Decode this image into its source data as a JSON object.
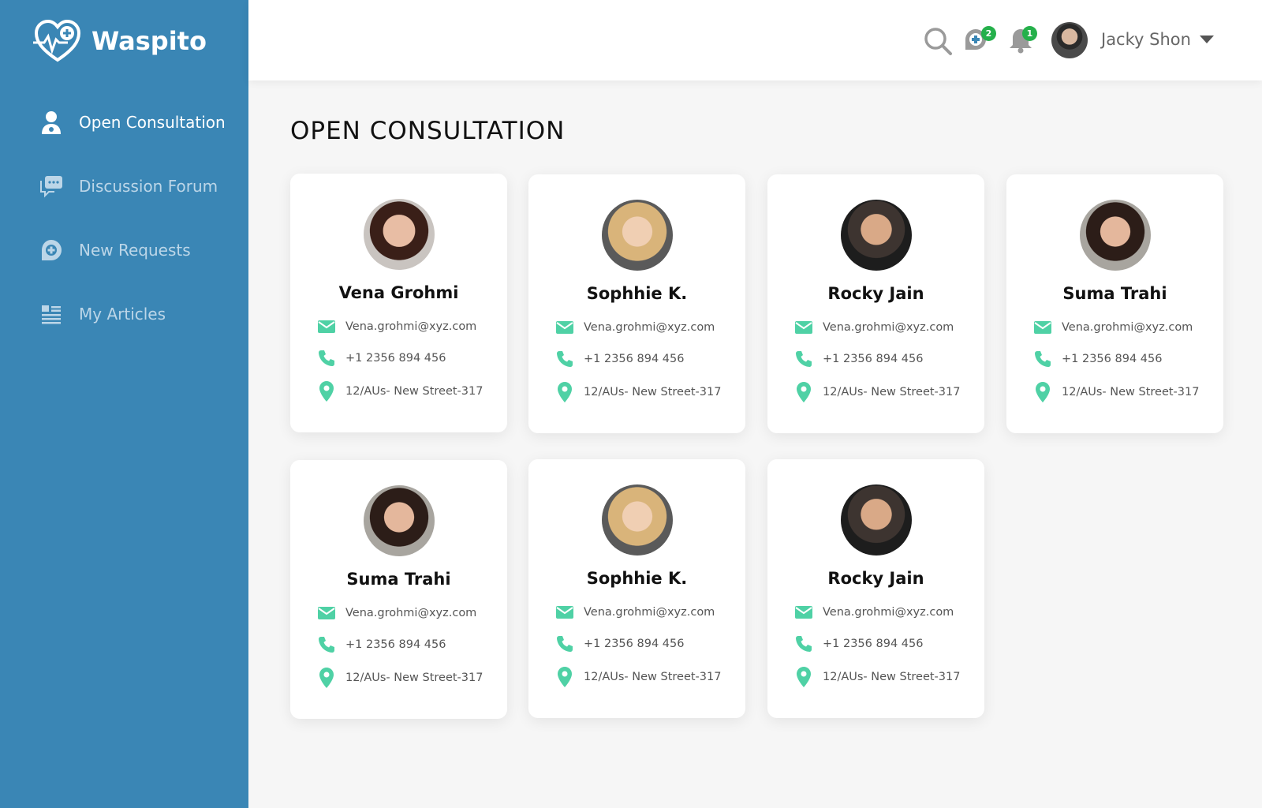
{
  "brand": {
    "name": "Waspito"
  },
  "sidebar": {
    "items": [
      {
        "label": "Open Consultation",
        "icon": "doctor-icon",
        "active": true
      },
      {
        "label": "Discussion Forum",
        "icon": "chat-icon",
        "active": false
      },
      {
        "label": "New Requests",
        "icon": "medical-plus-icon",
        "active": false
      },
      {
        "label": "My Articles",
        "icon": "articles-icon",
        "active": false
      }
    ]
  },
  "header": {
    "requests_badge": "2",
    "notifications_badge": "1",
    "user_name": "Jacky Shon"
  },
  "main": {
    "title": "OPEN CONSULTATION",
    "cards": [
      {
        "name": "Vena Grohmi",
        "email": "Vena.grohmi@xyz.com",
        "phone": "+1 2356 894 456",
        "address": "12/AUs- New Street-317"
      },
      {
        "name": "Sophhie K.",
        "email": "Vena.grohmi@xyz.com",
        "phone": "+1 2356 894 456",
        "address": "12/AUs- New Street-317"
      },
      {
        "name": "Rocky Jain",
        "email": "Vena.grohmi@xyz.com",
        "phone": "+1 2356 894 456",
        "address": "12/AUs- New Street-317"
      },
      {
        "name": "Suma Trahi",
        "email": "Vena.grohmi@xyz.com",
        "phone": "+1 2356 894 456",
        "address": "12/AUs- New Street-317"
      },
      {
        "name": "Suma Trahi",
        "email": "Vena.grohmi@xyz.com",
        "phone": "+1 2356 894 456",
        "address": "12/AUs- New Street-317"
      },
      {
        "name": "Sophhie K.",
        "email": "Vena.grohmi@xyz.com",
        "phone": "+1 2356 894 456",
        "address": "12/AUs- New Street-317"
      },
      {
        "name": "Rocky Jain",
        "email": "Vena.grohmi@xyz.com",
        "phone": "+1 2356 894 456",
        "address": "12/AUs- New Street-317"
      }
    ]
  },
  "colors": {
    "sidebar": "#3a86b5",
    "accent": "#4fd1a5",
    "badge": "#25b04b"
  }
}
